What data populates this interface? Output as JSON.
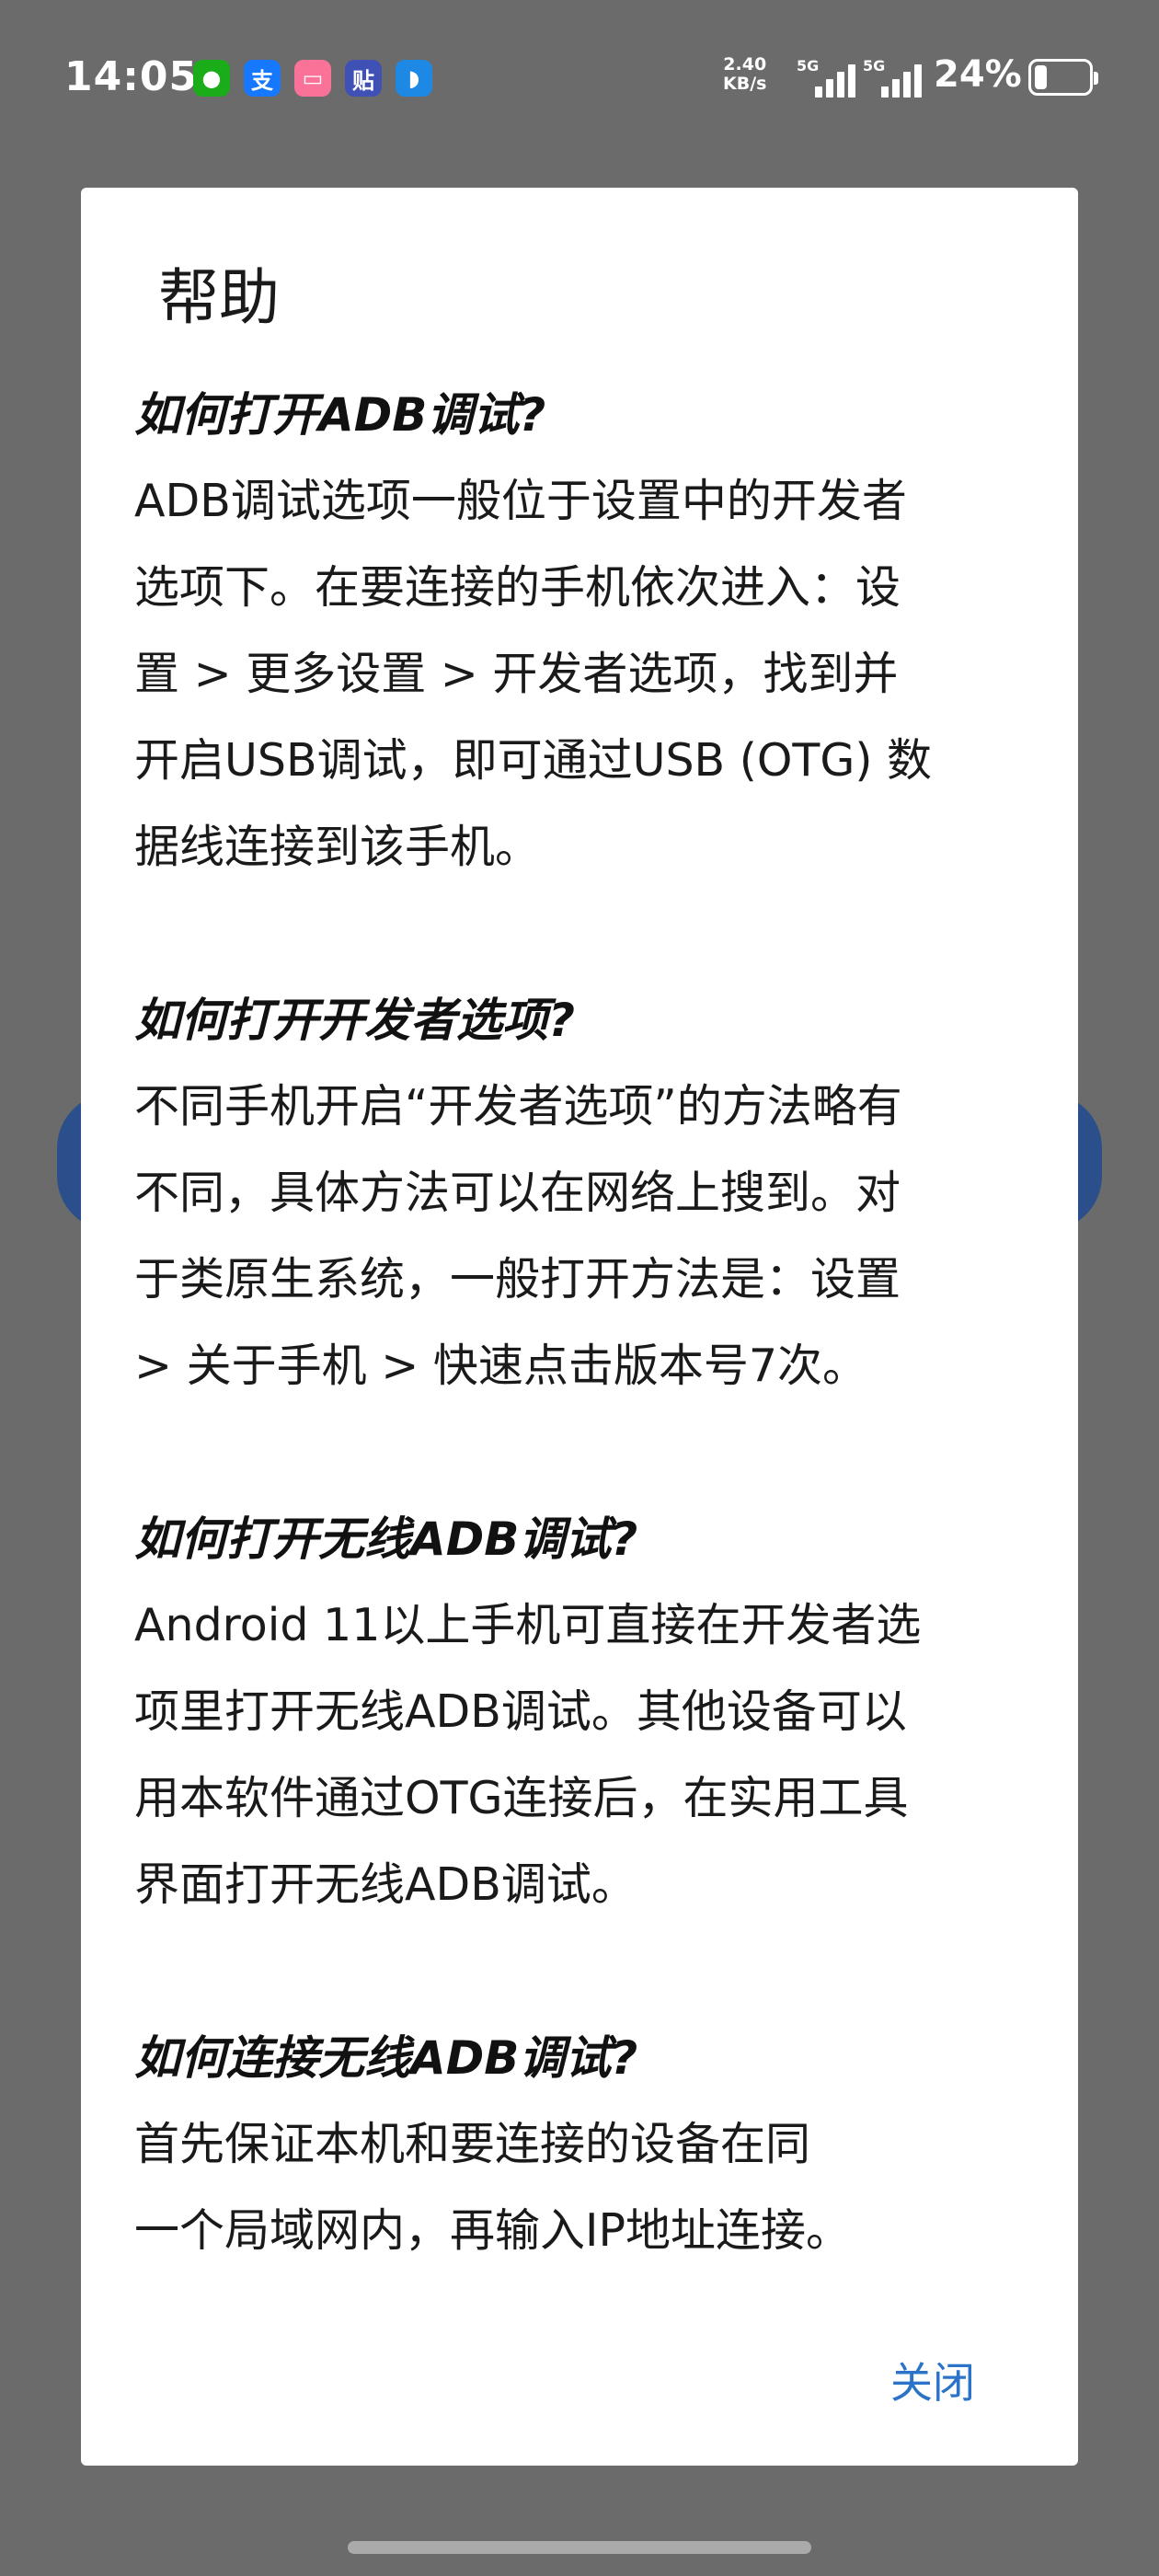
{
  "status_bar": {
    "time": "14:05",
    "net_speed_value": "2.40",
    "net_speed_unit": "KB/s",
    "signal1_label": "5G",
    "signal2_label": "5G",
    "battery_pct": "24%",
    "battery_level": 0.24,
    "app_icons": [
      {
        "name": "wechat-icon",
        "color": "#1aad19",
        "glyph": "●"
      },
      {
        "name": "alipay-icon",
        "color": "#1677ff",
        "glyph": "支"
      },
      {
        "name": "bilibili-icon",
        "color": "#fb7299",
        "glyph": "▭"
      },
      {
        "name": "tieba-icon",
        "color": "#3f51b5",
        "glyph": "贴"
      },
      {
        "name": "browser-icon",
        "color": "#1e88e5",
        "glyph": "◗"
      }
    ]
  },
  "dialog": {
    "title": "帮助",
    "sections": [
      {
        "question": "如何打开ADB调试?",
        "answer_lines": [
          "ADB调试选项一般位于设置中的开发者",
          "选项下。在要连接的手机依次进入：设",
          "置 > 更多设置 > 开发者选项，找到并",
          "开启USB调试，即可通过USB (OTG) 数",
          "据线连接到该手机。"
        ]
      },
      {
        "question": "如何打开开发者选项?",
        "answer_lines": [
          "不同手机开启“开发者选项”的方法略有",
          "不同，具体方法可以在网络上搜到。对",
          "于类原生系统，一般打开方法是：设置",
          "> 关于手机 > 快速点击版本号7次。"
        ]
      },
      {
        "question": "如何打开无线ADB调试?",
        "answer_lines": [
          "Android 11以上手机可直接在开发者选",
          "项里打开无线ADB调试。其他设备可以",
          "用本软件通过OTG连接后，在实用工具",
          "界面打开无线ADB调试。"
        ]
      },
      {
        "question": "如何连接无线ADB调试?",
        "answer_lines": [
          "首先保证本机和要连接的设备在同",
          "一个局域网内，再输入IP地址连接。"
        ]
      }
    ],
    "close_label": "关闭"
  },
  "colors": {
    "overlay": "#6b6b6b",
    "accent": "#2a73c9",
    "dialog_bg": "#ffffff"
  }
}
